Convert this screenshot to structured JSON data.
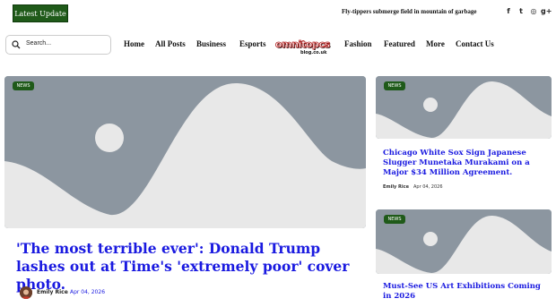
{
  "topbar": {
    "latest_label": "Latest Update",
    "ticker": "Fly-tippers submerge field in mountain of garbage",
    "social": [
      {
        "icon": "facebook-icon",
        "glyph": "f"
      },
      {
        "icon": "twitter-icon",
        "glyph": "t"
      },
      {
        "icon": "instagram-icon",
        "glyph": "◎"
      },
      {
        "icon": "google-plus-icon",
        "glyph": "g+"
      }
    ]
  },
  "search": {
    "placeholder": "Search..."
  },
  "nav": {
    "home": "Home",
    "all_posts": "All Posts",
    "business": "Business",
    "esports": "Esports",
    "fashion": "Fashion",
    "featured": "Featured",
    "more": "More",
    "contact": "Contact Us"
  },
  "logo": {
    "main": "omnitopcs",
    "sub": "blog.co.uk"
  },
  "main_article": {
    "badge": "NEWS",
    "title": "'The most terrible ever': Donald Trump lashes out at Time's 'extremely poor' cover photo.",
    "author": "Emily Rice",
    "date": "Apr 04, 2026"
  },
  "side_articles": [
    {
      "badge": "NEWS",
      "title": "Chicago White Sox Sign Japanese Slugger Munetaka Murakami on a Major $34 Million Agreement.",
      "author": "Emily Rice",
      "date": "Apr 04, 2026"
    },
    {
      "badge": "NEWS",
      "title": "Must-See US Art Exhibitions Coming in 2026"
    }
  ],
  "colors": {
    "accent_green": "#1f5a19",
    "link_blue": "#1a1ae0",
    "placeholder_gray": "#8c96a0",
    "logo_red": "#b01818"
  }
}
